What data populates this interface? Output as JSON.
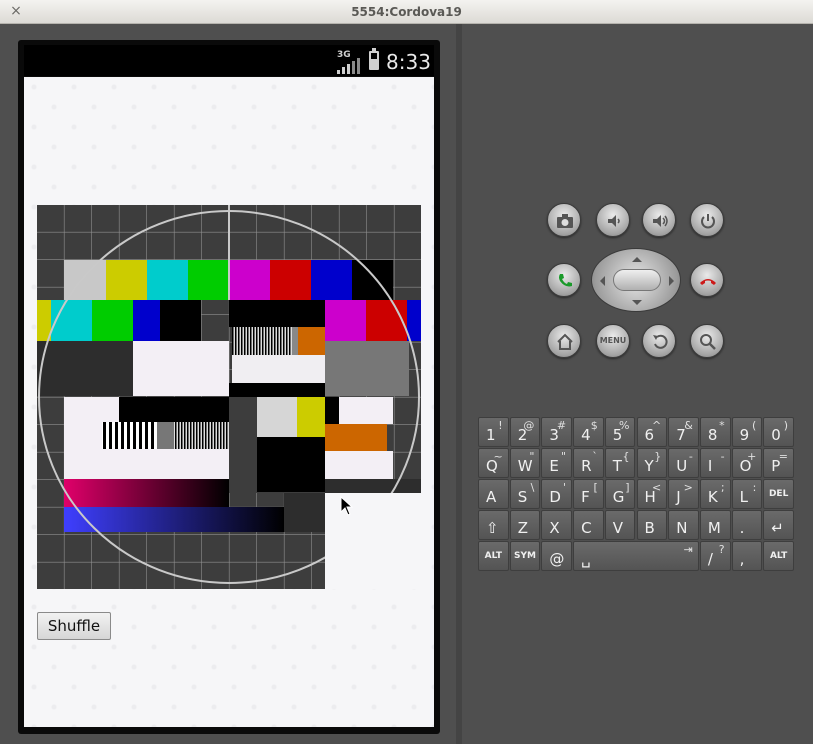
{
  "window": {
    "title": "5554:Cordova19",
    "close_glyph": "×"
  },
  "statusbar": {
    "network": "3G",
    "time": "8:33"
  },
  "app": {
    "shuffle_label": "Shuffle"
  },
  "controls": {
    "menu_label": "MENU"
  },
  "keyboard": {
    "rows": [
      [
        [
          "1",
          "!"
        ],
        [
          "2",
          "@"
        ],
        [
          "3",
          "#"
        ],
        [
          "4",
          "$"
        ],
        [
          "5",
          "%"
        ],
        [
          "6",
          "^"
        ],
        [
          "7",
          "&"
        ],
        [
          "8",
          "*"
        ],
        [
          "9",
          "("
        ],
        [
          "0",
          ")"
        ]
      ],
      [
        [
          "Q",
          "~"
        ],
        [
          "W",
          "\""
        ],
        [
          "E",
          "\""
        ],
        [
          "R",
          "`"
        ],
        [
          "T",
          "{"
        ],
        [
          "Y",
          "}"
        ],
        [
          "U",
          "-"
        ],
        [
          "I",
          "-"
        ],
        [
          "O",
          "+"
        ],
        [
          "P",
          "="
        ]
      ],
      [
        [
          "A",
          ""
        ],
        [
          "S",
          "\\"
        ],
        [
          "D",
          "'"
        ],
        [
          "F",
          "["
        ],
        [
          "G",
          "]"
        ],
        [
          "H",
          "<"
        ],
        [
          "J",
          ">"
        ],
        [
          "K",
          ";"
        ],
        [
          "L",
          ":"
        ],
        [
          "DEL",
          ""
        ]
      ],
      [
        [
          "⇧",
          ""
        ],
        [
          "Z",
          ""
        ],
        [
          "X",
          ""
        ],
        [
          "C",
          ""
        ],
        [
          "V",
          ""
        ],
        [
          "B",
          ""
        ],
        [
          "N",
          ""
        ],
        [
          "M",
          ""
        ],
        [
          ".",
          ""
        ],
        [
          "↵",
          ""
        ]
      ],
      [
        [
          "ALT",
          ""
        ],
        [
          "SYM",
          ""
        ],
        [
          "@",
          ""
        ],
        [
          "␣",
          "⇥"
        ],
        [
          "/",
          "?"
        ],
        [
          ",",
          ""
        ],
        [
          "ALT",
          ""
        ]
      ]
    ]
  },
  "colors": {
    "screen_bg": "#f6f6f8",
    "test_pattern_bars": [
      "#c8c8c8",
      "#cccc00",
      "#00cccc",
      "#00cc00",
      "#cc00cc",
      "#cc0000",
      "#0000cc",
      "#000000"
    ]
  },
  "icons": {
    "camera": "camera-icon",
    "volume_down": "volume-down-icon",
    "volume_up": "volume-up-icon",
    "power": "power-icon",
    "call": "call-icon",
    "end_call": "end-call-icon",
    "home": "home-icon",
    "back": "back-icon",
    "search": "search-icon"
  }
}
